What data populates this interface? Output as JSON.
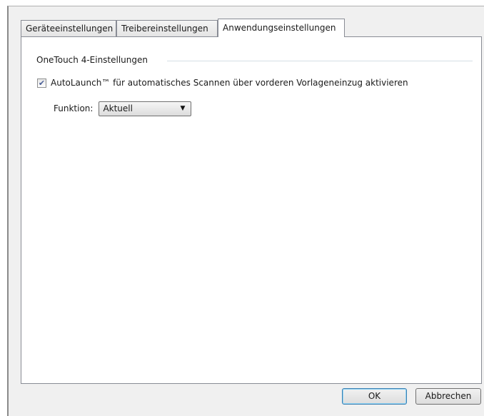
{
  "tabs": [
    {
      "label": "Geräteeinstellungen",
      "active": false
    },
    {
      "label": "Treibereinstellungen",
      "active": false
    },
    {
      "label": "Anwendungseinstellungen",
      "active": true
    }
  ],
  "group": {
    "title": "OneTouch 4-Einstellungen"
  },
  "autolaunch": {
    "label": "AutoLaunch™ für automatisches Scannen über vorderen Vorlageneinzug aktivieren",
    "checked": true,
    "check_glyph": "✔"
  },
  "function": {
    "label": "Funktion:",
    "selected": "Aktuell",
    "dropdown_icon": "chevron-down-icon",
    "caret_glyph": "▼"
  },
  "buttons": {
    "ok_label": "OK",
    "cancel_label": "Abbrechen"
  },
  "colors": {
    "dialog_background": "#f0f0f0",
    "panel_background": "#ffffff",
    "default_button_border": "#3c7fb1",
    "check_color": "#4a5f97"
  }
}
